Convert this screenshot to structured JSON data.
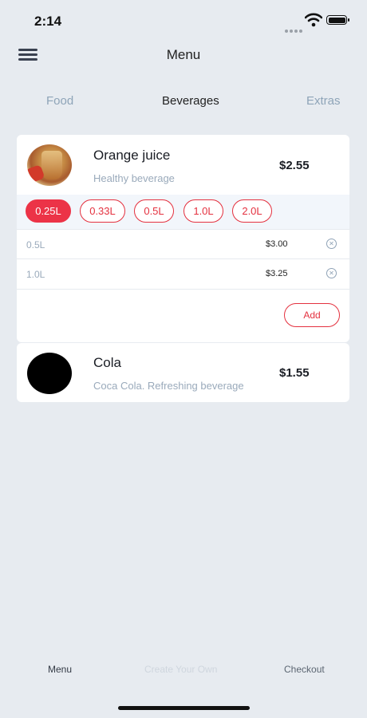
{
  "status_bar": {
    "time": "2:14"
  },
  "header": {
    "title": "Menu"
  },
  "tabs": [
    {
      "label": "Food",
      "active": false
    },
    {
      "label": "Beverages",
      "active": true
    },
    {
      "label": "Extras",
      "active": false
    }
  ],
  "products": [
    {
      "name": "Orange juice",
      "description": "Healthy beverage",
      "price": "$2.55",
      "sizes": [
        "0.25L",
        "0.33L",
        "0.5L",
        "1.0L",
        "2.0L"
      ],
      "selected_size": "0.25L",
      "added": [
        {
          "size": "0.5L",
          "price": "$3.00"
        },
        {
          "size": "1.0L",
          "price": "$3.25"
        }
      ],
      "add_label": "Add"
    },
    {
      "name": "Cola",
      "description": "Coca Cola. Refreshing beverage",
      "price": "$1.55"
    }
  ],
  "bottom_nav": {
    "menu": "Menu",
    "create": "Create Your Own",
    "checkout": "Checkout"
  },
  "colors": {
    "accent": "#ec3347",
    "background": "#e7ebf0",
    "muted": "#9aaabb"
  }
}
